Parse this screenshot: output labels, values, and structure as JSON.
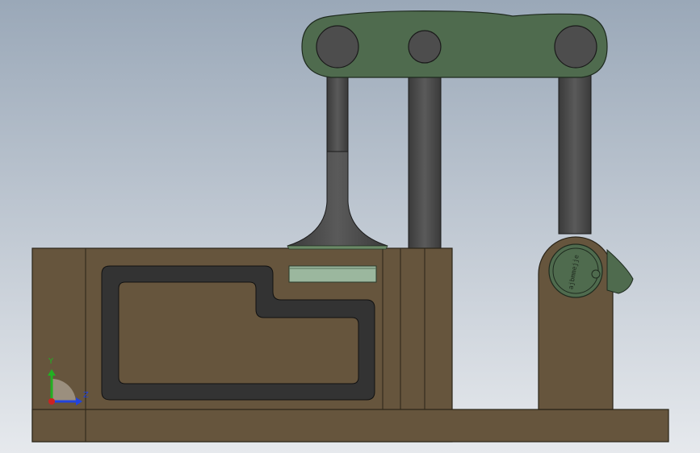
{
  "viewport": {
    "background_top": "#9aa8b8",
    "background_bottom": "#e6e9ed"
  },
  "colors": {
    "base_body": "#66553d",
    "base_edge": "#2a2418",
    "rocker_arm": "#4f6b4e",
    "rocker_edge": "#1e2a1e",
    "pivot_hole": "#4d4d4d",
    "push_rod": "#4a4a4a",
    "cavity_dark": "#333333",
    "plate": "#9bb79e",
    "valve_seat": "#6b8a67"
  },
  "triad": {
    "y_label": "Y",
    "z_label": "Z",
    "y_color": "#22b022",
    "z_color": "#2244dd",
    "x_color": "#cc2222"
  },
  "engraving": {
    "text": "ajbmmejje"
  }
}
